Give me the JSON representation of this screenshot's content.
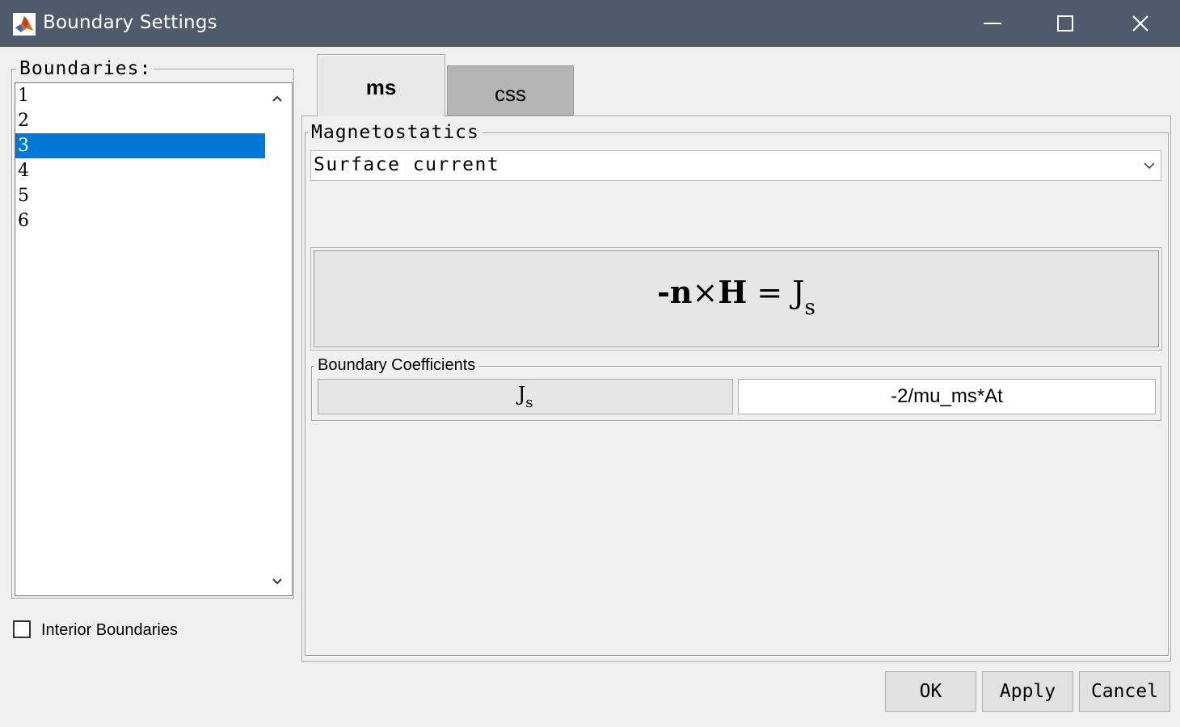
{
  "window": {
    "title": "Boundary Settings",
    "icons": {
      "app": "matlab-logo-icon",
      "minimize": "minimize-icon",
      "maximize": "maximize-icon",
      "close": "close-icon"
    }
  },
  "boundaries": {
    "legend": "Boundaries:",
    "items": [
      "1",
      "2",
      "3",
      "4",
      "5",
      "6"
    ],
    "selected": "3"
  },
  "interior": {
    "label": "Interior Boundaries",
    "checked": false
  },
  "tabs": [
    {
      "label": "ms",
      "active": true
    },
    {
      "label": "css",
      "active": false
    }
  ],
  "magnetostatics": {
    "legend": "Magnetostatics",
    "condition": "Surface current"
  },
  "equation": {
    "minus": "-",
    "n": "n",
    "times": "×",
    "H": "H",
    "equals": " = ",
    "J": "J",
    "sub": "s"
  },
  "coefficients": {
    "legend": "Boundary Coefficients",
    "label": "J",
    "label_sub": "s",
    "value": "-2/mu_ms*At"
  },
  "buttons": {
    "ok": "OK",
    "apply": "Apply",
    "cancel": "Cancel"
  },
  "colors": {
    "titlebar": "#4f5b6a",
    "selection": "#0078d7",
    "inactive_tab": "#b5b5b5"
  }
}
